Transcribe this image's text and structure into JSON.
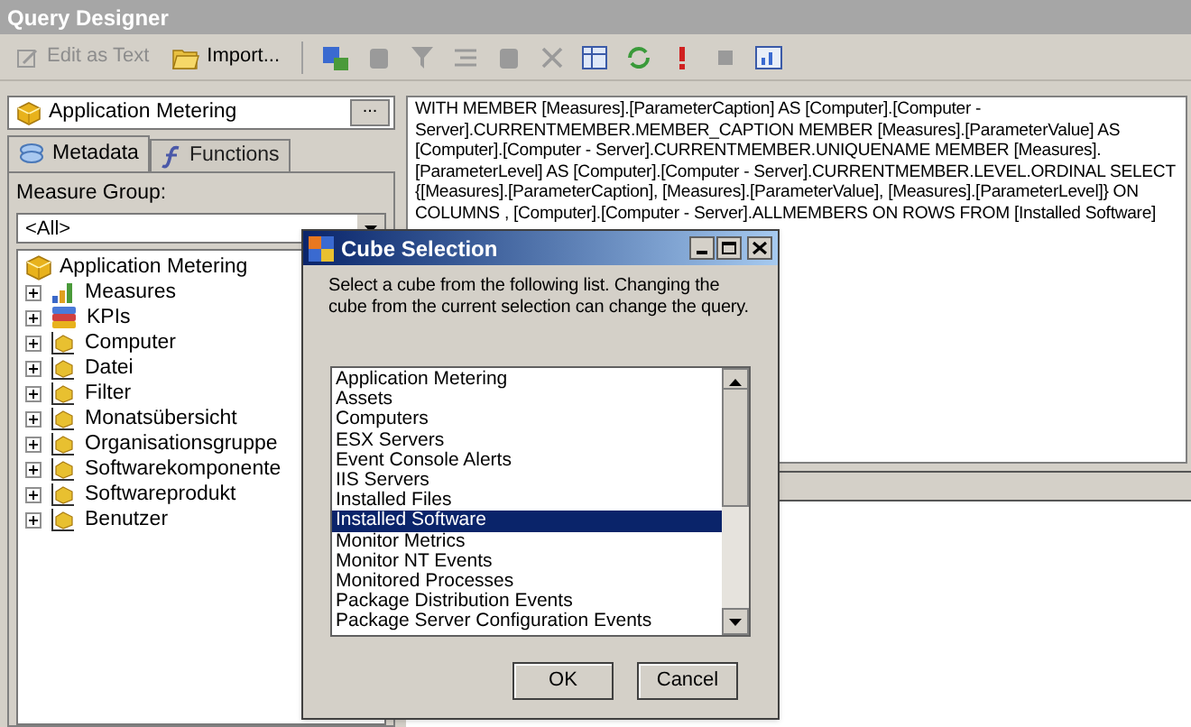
{
  "window": {
    "title": "Query Designer"
  },
  "toolbar": {
    "buttons": [
      {
        "label": "Edit as Text",
        "disabled": true,
        "kind": "edit"
      },
      {
        "label": "Import...",
        "disabled": false,
        "kind": "import"
      }
    ],
    "icons": [
      {
        "kind": "cube",
        "disabled": false
      },
      {
        "kind": "block",
        "disabled": true
      },
      {
        "kind": "funnel",
        "disabled": true
      },
      {
        "kind": "lines",
        "disabled": true
      },
      {
        "kind": "block",
        "disabled": true
      },
      {
        "kind": "cross",
        "disabled": true
      },
      {
        "kind": "table",
        "disabled": false
      },
      {
        "kind": "refresh",
        "disabled": false
      },
      {
        "kind": "exclaim",
        "disabled": false
      },
      {
        "kind": "square",
        "disabled": true
      },
      {
        "kind": "chart",
        "disabled": false
      }
    ]
  },
  "cube_field": {
    "value": "Application Metering",
    "button": "..."
  },
  "tabs": [
    {
      "label": "Metadata",
      "selected": true,
      "kind": "metadata"
    },
    {
      "label": "Functions",
      "selected": false,
      "kind": "functions"
    }
  ],
  "measure_group": {
    "label": "Measure Group:",
    "value": "<All>"
  },
  "tree": [
    {
      "label": "Application Metering",
      "kind": "cube",
      "children": [
        {
          "label": "Measures",
          "kind": "measures",
          "expanded": false
        },
        {
          "label": "KPIs",
          "kind": "kpis",
          "expanded": false
        },
        {
          "label": "Computer",
          "kind": "dimension",
          "expanded": false
        },
        {
          "label": "Datei",
          "kind": "dimension",
          "expanded": false
        },
        {
          "label": "Filter",
          "kind": "dimension",
          "expanded": false
        },
        {
          "label": "Monatsübersicht",
          "kind": "dimension",
          "expanded": false
        },
        {
          "label": "Organisationsgruppe",
          "kind": "dimension",
          "expanded": false
        },
        {
          "label": "Softwarekomponente",
          "kind": "dimension",
          "expanded": false
        },
        {
          "label": "Softwareprodukt",
          "kind": "dimension",
          "expanded": false
        },
        {
          "label": "Benutzer",
          "kind": "dimension",
          "expanded": false
        }
      ]
    }
  ],
  "query_text": "WITH MEMBER [Measures].[ParameterCaption] AS [Computer].[Computer - Server].CURRENTMEMBER.MEMBER_CAPTION MEMBER [Measures].[ParameterValue] AS [Computer].[Computer - Server].CURRENTMEMBER.UNIQUENAME MEMBER [Measures].[ParameterLevel] AS [Computer].[Computer - Server].CURRENTMEMBER.LEVEL.ORDINAL SELECT {[Measures].[ParameterCaption], [Measures].[ParameterValue], [Measures].[ParameterLevel]} ON COLUMNS , [Computer].[Computer - Server].ALLMEMBERS ON ROWS FROM [Installed Software]",
  "dialog": {
    "title": "Cube Selection",
    "message": "Select a cube from the following list. Changing the cube from the current selection can change the query.",
    "cubes": [
      {
        "label": "Application Metering",
        "selected": false
      },
      {
        "label": "Assets",
        "selected": false
      },
      {
        "label": "Computers",
        "selected": false
      },
      {
        "label": "ESX Servers",
        "selected": false
      },
      {
        "label": "Event Console Alerts",
        "selected": false
      },
      {
        "label": "IIS Servers",
        "selected": false
      },
      {
        "label": "Installed Files",
        "selected": false
      },
      {
        "label": "Installed Software",
        "selected": true
      },
      {
        "label": "Monitor Metrics",
        "selected": false
      },
      {
        "label": "Monitor NT Events",
        "selected": false
      },
      {
        "label": "Monitored Processes",
        "selected": false
      },
      {
        "label": "Package Distribution Events",
        "selected": false
      },
      {
        "label": "Package Server Configuration Events",
        "selected": false
      }
    ],
    "buttons": [
      "OK",
      "Cancel"
    ]
  }
}
